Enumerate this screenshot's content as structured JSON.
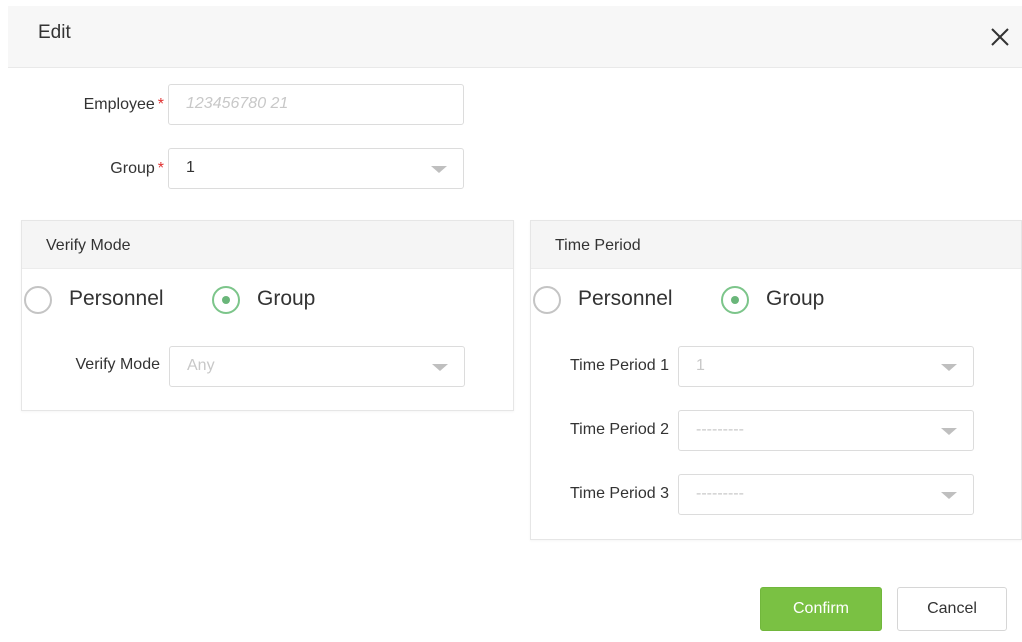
{
  "dialog": {
    "title": "Edit"
  },
  "form": {
    "employee": {
      "label": "Employee",
      "required_mark": "*",
      "placeholder": "123456780 21"
    },
    "group": {
      "label": "Group",
      "required_mark": "*",
      "value": "1"
    }
  },
  "verify_mode_panel": {
    "header": "Verify Mode",
    "options": {
      "personnel": "Personnel",
      "group": "Group"
    },
    "selected": "Group",
    "select": {
      "label": "Verify Mode",
      "value": "Any"
    }
  },
  "time_period_panel": {
    "header": "Time Period",
    "options": {
      "personnel": "Personnel",
      "group": "Group"
    },
    "selected": "Group",
    "periods": [
      {
        "label": "Time Period 1",
        "value": "1"
      },
      {
        "label": "Time Period 2",
        "value": "---------"
      },
      {
        "label": "Time Period 3",
        "value": "---------"
      }
    ]
  },
  "buttons": {
    "confirm": "Confirm",
    "cancel": "Cancel"
  },
  "colors": {
    "accent": "#7ac143",
    "required": "#e02f2f",
    "radio_selected": "#6ab67a"
  },
  "icons": {
    "close": "close-icon",
    "dropdown": "chevron-down-icon"
  }
}
